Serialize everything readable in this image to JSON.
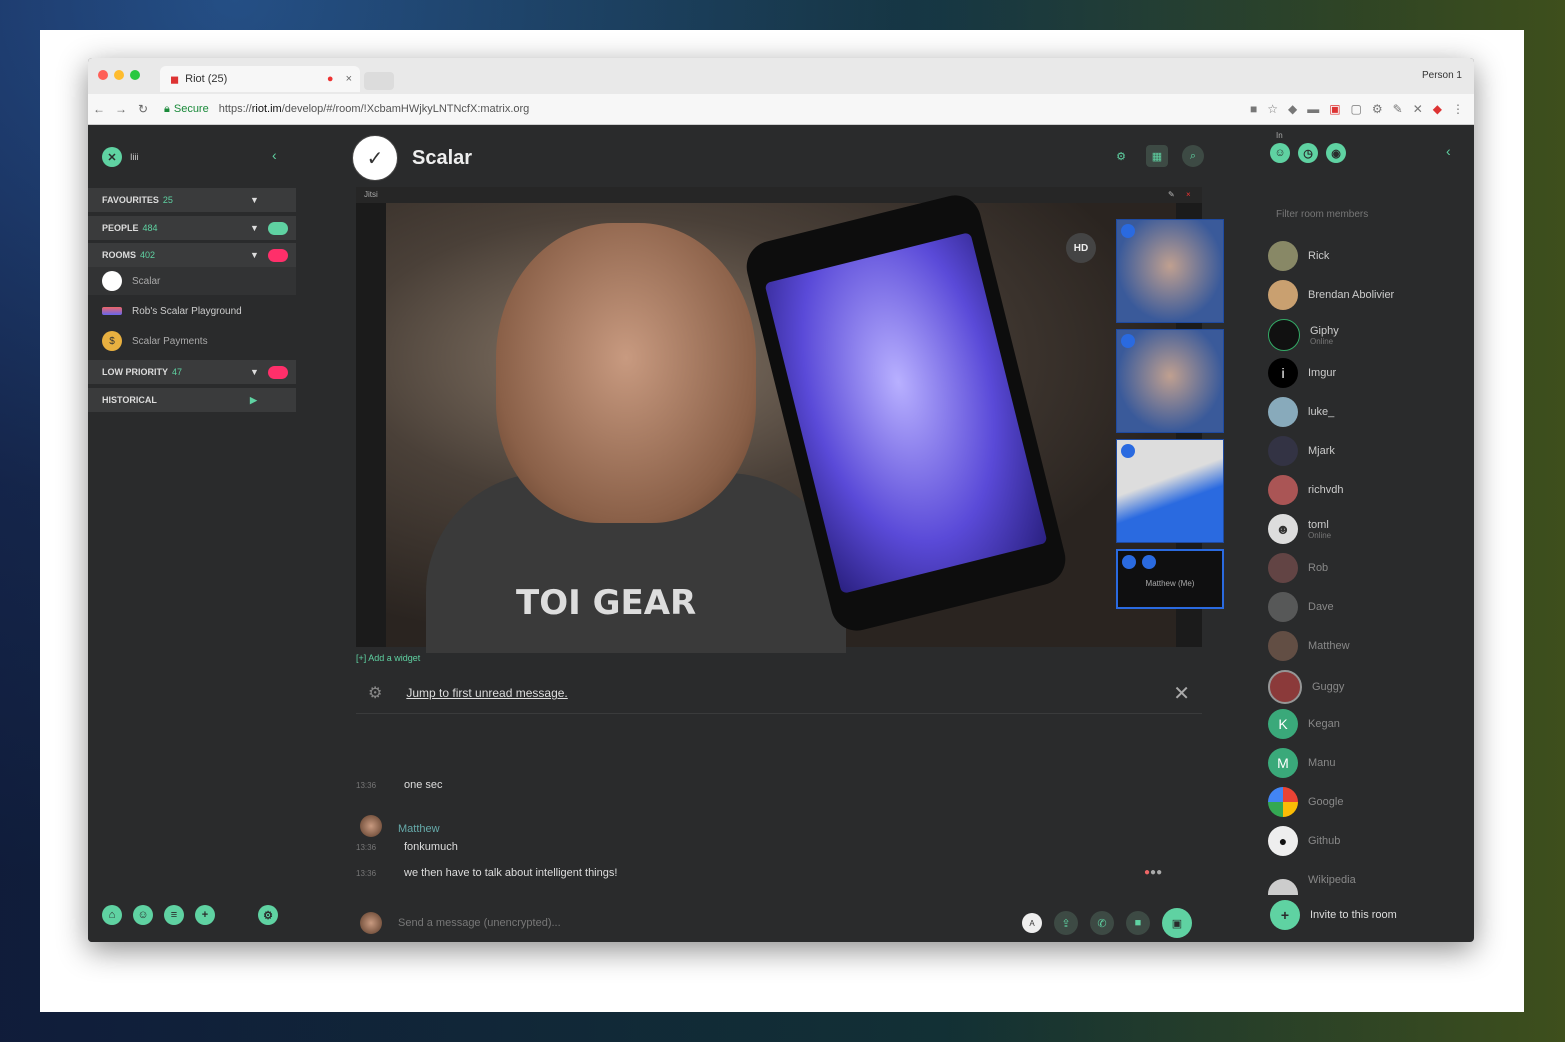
{
  "browser": {
    "tab_title": "Riot (25)",
    "profile": "Person 1",
    "secure_label": "Secure",
    "url_prefix": "https://",
    "url_host": "riot.im",
    "url_rest": "/develop/#/room/!XcbamHWjkyLNTNcfX:matrix.org"
  },
  "left": {
    "top_label": "Iiii",
    "sections": [
      {
        "name": "FAVOURITES",
        "count": "25"
      },
      {
        "name": "PEOPLE",
        "count": "484",
        "badge": "#5fd2a2"
      },
      {
        "name": "ROOMS",
        "count": "402",
        "badge": "#ff2f6a"
      },
      {
        "name": "LOW PRIORITY",
        "count": "47",
        "badge": "#ff2f6a"
      },
      {
        "name": "HISTORICAL",
        "count": ""
      }
    ],
    "rooms": [
      {
        "name": "Scalar"
      },
      {
        "name": "Rob's Scalar Playground"
      },
      {
        "name": "Scalar Payments"
      }
    ]
  },
  "center": {
    "room_title": "Scalar",
    "video_bar": "Jitsi",
    "hd_label": "HD",
    "shirt_text": "TOI GEAR",
    "self_view_name": "Matthew (Me)",
    "add_widget": "[+] Add a widget",
    "jump_unread": "Jump to first unread message.",
    "messages": [
      {
        "ts": "13:36",
        "text": "one sec"
      },
      {
        "ts": "13:36",
        "text": "fonkumuch"
      },
      {
        "ts": "13:36",
        "text": "we then have to talk about intelligent things!"
      }
    ],
    "sender": "Matthew",
    "composer_placeholder": "Send a message (unencrypted)...",
    "emoji_label": "A"
  },
  "right": {
    "header_label": "In",
    "filter_placeholder": "Filter room members",
    "members": [
      {
        "name": "Rick",
        "sub": ""
      },
      {
        "name": "Brendan Abolivier",
        "sub": ""
      },
      {
        "name": "Giphy",
        "sub": "Online"
      },
      {
        "name": "Imgur",
        "sub": ""
      },
      {
        "name": "luke_",
        "sub": ""
      },
      {
        "name": "Mjark",
        "sub": ""
      },
      {
        "name": "richvdh",
        "sub": ""
      },
      {
        "name": "toml",
        "sub": "Online"
      },
      {
        "name": "Rob",
        "sub": ""
      },
      {
        "name": "Dave",
        "sub": ""
      },
      {
        "name": "Matthew",
        "sub": ""
      },
      {
        "name": "Guggy",
        "sub": ""
      },
      {
        "name": "Kegan",
        "sub": ""
      },
      {
        "name": "Manu",
        "sub": ""
      },
      {
        "name": "Google",
        "sub": ""
      },
      {
        "name": "Github",
        "sub": ""
      },
      {
        "name": "Wikipedia",
        "sub": ""
      }
    ],
    "invite_label": "Invite to this room"
  },
  "colors": {
    "accent": "#5fd2a2",
    "alert": "#ff2f6a"
  }
}
